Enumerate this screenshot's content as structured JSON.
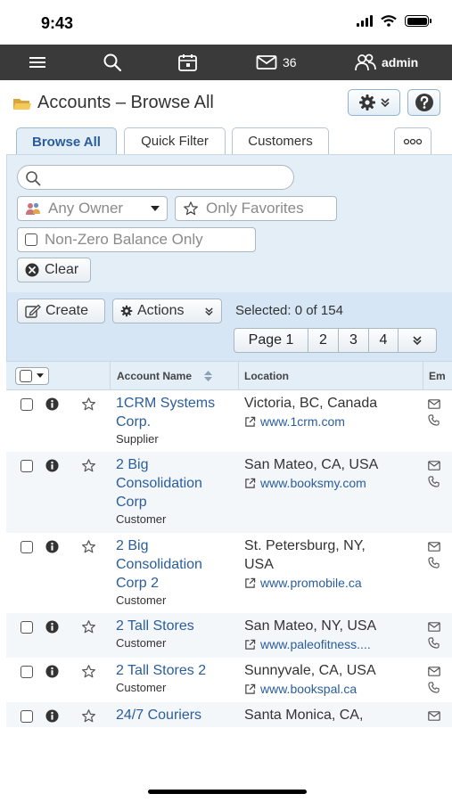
{
  "status_bar": {
    "time": "9:43"
  },
  "navbar": {
    "mail_count": "36",
    "user": "admin"
  },
  "header": {
    "title": "Accounts – Browse All"
  },
  "tabs": [
    {
      "label": "Browse All"
    },
    {
      "label": "Quick Filter"
    },
    {
      "label": "Customers"
    }
  ],
  "filters": {
    "search_value": "",
    "owner_label": "Any Owner",
    "favorites_label": "Only Favorites",
    "nonzero_label": "Non-Zero Balance Only",
    "clear_label": "Clear"
  },
  "toolbar": {
    "create_label": "Create",
    "actions_label": "Actions",
    "selected_text": "Selected: 0 of 154"
  },
  "pagination": {
    "page_label": "Page 1",
    "pages": [
      "2",
      "3",
      "4"
    ]
  },
  "table": {
    "headers": {
      "account_name": "Account Name",
      "location": "Location",
      "email": "Em"
    },
    "rows": [
      {
        "name_lines": [
          "1CRM Systems",
          "Corp."
        ],
        "type": "Supplier",
        "location_lines": [
          "Victoria, BC, Canada"
        ],
        "website": "www.1crm.com"
      },
      {
        "name_lines": [
          "2 Big",
          "Consolidation",
          "Corp"
        ],
        "type": "Customer",
        "location_lines": [
          "San Mateo, CA, USA"
        ],
        "website": "www.booksmy.com"
      },
      {
        "name_lines": [
          "2 Big",
          "Consolidation",
          "Corp 2"
        ],
        "type": "Customer",
        "location_lines": [
          "St. Petersburg, NY,",
          "USA"
        ],
        "website": "www.promobile.ca"
      },
      {
        "name_lines": [
          "2 Tall Stores"
        ],
        "type": "Customer",
        "location_lines": [
          "San Mateo, NY, USA"
        ],
        "website": "www.paleofitness...."
      },
      {
        "name_lines": [
          "2 Tall Stores 2"
        ],
        "type": "Customer",
        "location_lines": [
          "Sunnyvale, CA, USA"
        ],
        "website": "www.bookspal.ca"
      },
      {
        "name_lines": [
          "24/7 Couriers"
        ],
        "type": "",
        "location_lines": [
          "Santa Monica, CA,"
        ],
        "website": ""
      }
    ]
  },
  "colors": {
    "navbar": "#3a3a3a",
    "link": "#2a5d9c",
    "panel": "#e4eef7"
  }
}
